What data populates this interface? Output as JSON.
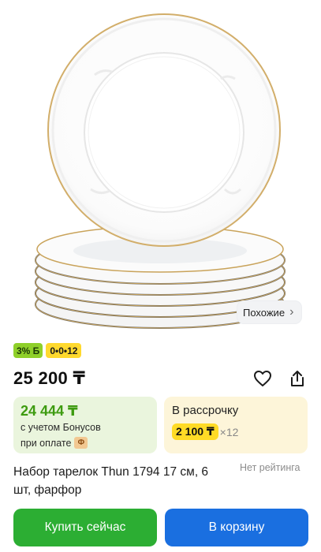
{
  "similar_chip": {
    "label": "Похожие",
    "icon": "chevron-right-icon"
  },
  "badges": {
    "cashback": "3% Б",
    "installment": "0•0•12"
  },
  "price": {
    "value": "25 200 ₸"
  },
  "actions": {
    "favorite_icon": "heart-icon",
    "share_icon": "share-icon"
  },
  "bonus_card": {
    "price": "24 444 ₸",
    "line1": "с учетом Бонусов",
    "line2": "при оплате",
    "icon_glyph": "Ф"
  },
  "installment_card": {
    "title": "В рассрочку",
    "amount": "2 100 ₸",
    "times": "×12"
  },
  "product": {
    "title": "Набор тарелок Thun 1794 17 см, 6 шт, фарфор",
    "rating_text": "Нет рейтинга"
  },
  "buttons": {
    "buy_now": "Купить сейчас",
    "add_to_cart": "В корзину"
  },
  "colors": {
    "buy_button": "#2cae33",
    "cart_button": "#1a6fe0",
    "bonus_price": "#3d9b0f",
    "installment_badge": "#ffdb26"
  }
}
